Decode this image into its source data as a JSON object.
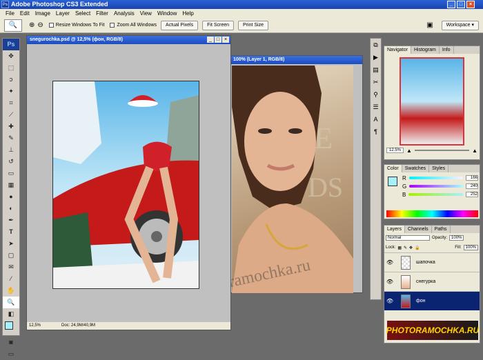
{
  "app": {
    "title": "Adobe Photoshop CS3 Extended",
    "icon": "Ps"
  },
  "menu": [
    "File",
    "Edit",
    "Image",
    "Layer",
    "Select",
    "Filter",
    "Analysis",
    "View",
    "Window",
    "Help"
  ],
  "options": {
    "resize": "Resize Windows To Fit",
    "zoomall": "Zoom All Windows",
    "actual": "Actual Pixels",
    "fit": "Fit Screen",
    "print": "Print Size",
    "workspace": "Workspace"
  },
  "doc1": {
    "title": "snegurochka.psd @ 12,5% (фон, RGB/8)",
    "zoom": "12,5%",
    "docsize": "Doc: 24,9M/40,9M"
  },
  "doc2": {
    "title": "100% (Layer 1, RGB/8)"
  },
  "navigator": {
    "tabs": [
      "Navigator",
      "Histogram",
      "Info"
    ],
    "zoom": "12.5%"
  },
  "color": {
    "tabs": [
      "Color",
      "Swatches",
      "Styles"
    ],
    "r_label": "R",
    "g_label": "G",
    "b_label": "B",
    "r": "166",
    "g": "240",
    "b": "252",
    "swatch": "#a6f0fc"
  },
  "layers": {
    "tabs": [
      "Layers",
      "Channels",
      "Paths"
    ],
    "mode": "Normal",
    "opacity_label": "Opacity:",
    "opacity": "100%",
    "lock_label": "Lock:",
    "fill_label": "Fill:",
    "fill": "100%",
    "items": [
      "шапочка",
      "снегурка",
      "фон"
    ]
  },
  "watermark": "Photoramochka.ru",
  "brand": "PHOTORAMOCHKA.RU"
}
